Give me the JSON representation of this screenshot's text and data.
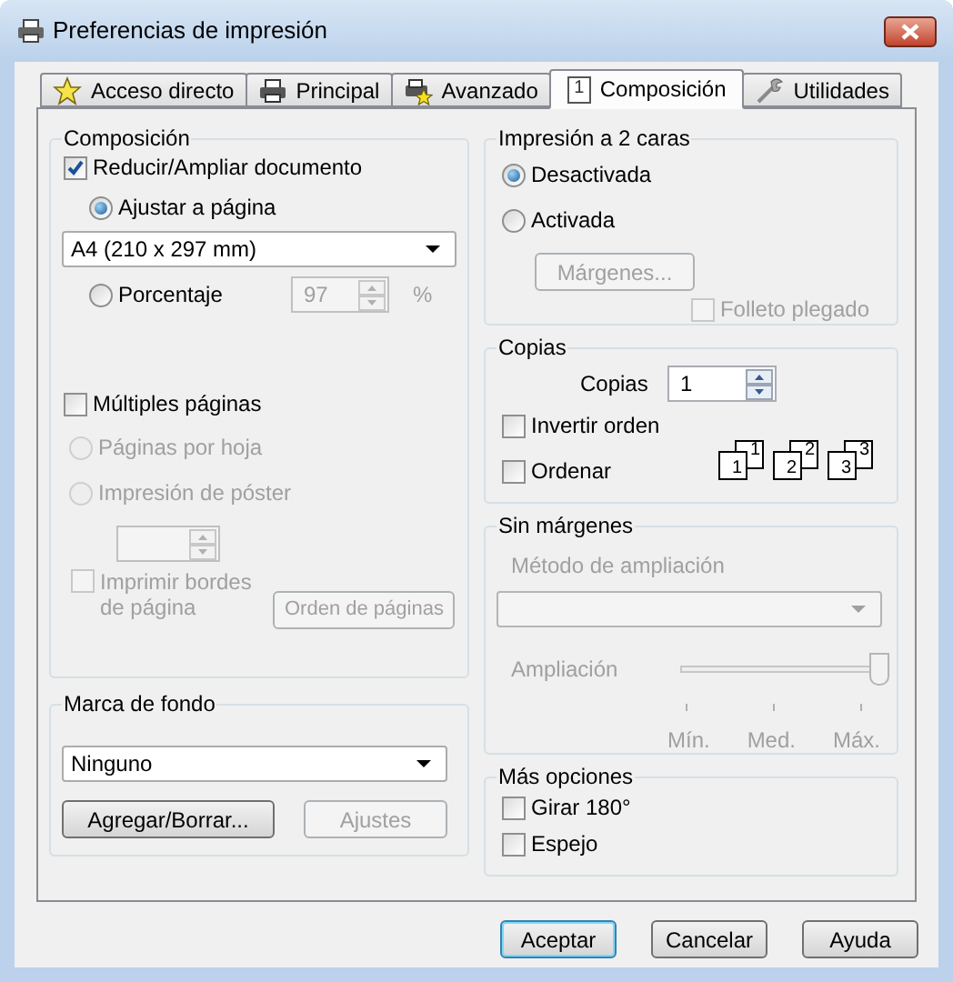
{
  "window": {
    "title": "Preferencias de impresión"
  },
  "tabs": [
    {
      "label": "Acceso directo",
      "kind": "star",
      "selected": false
    },
    {
      "label": "Principal",
      "kind": "printer",
      "selected": false
    },
    {
      "label": "Avanzado",
      "kind": "printer-star",
      "selected": false
    },
    {
      "label": "Composición",
      "kind": "page",
      "icon_label": "1",
      "selected": true
    },
    {
      "label": "Utilidades",
      "kind": "wrench",
      "selected": false
    }
  ],
  "composition": {
    "title": "Composición",
    "reduce": {
      "label": "Reducir/Ampliar documento",
      "checked": true
    },
    "fit_page": {
      "label": "Ajustar a página",
      "selected": true
    },
    "paper_size": {
      "value": "A4 (210 x 297 mm)"
    },
    "percentage": {
      "label": "Porcentaje",
      "selected": false,
      "value": "97",
      "unit": "%",
      "disabled": true
    },
    "multiple_pages": {
      "label": "Múltiples páginas",
      "checked": false
    },
    "pages_per_sheet": {
      "label": "Páginas por hoja",
      "selected": false,
      "disabled": true
    },
    "poster": {
      "label": "Impresión de póster",
      "selected": false,
      "disabled": true
    },
    "poster_count": {
      "disabled": true
    },
    "print_borders": {
      "label": "Imprimir bordes de página",
      "checked": false,
      "disabled": true
    },
    "page_order_button": {
      "label": "Orden de páginas",
      "disabled": true
    }
  },
  "watermark": {
    "title": "Marca de fondo",
    "value": "Ninguno",
    "buttons": [
      {
        "label": "Agregar/Borrar...",
        "disabled": false
      },
      {
        "label": "Ajustes",
        "disabled": true
      }
    ]
  },
  "duplex": {
    "title": "Impresión a 2 caras",
    "options": [
      {
        "label": "Desactivada",
        "selected": true
      },
      {
        "label": "Activada",
        "selected": false
      }
    ],
    "margins_button": {
      "label": "Márgenes...",
      "disabled": true
    },
    "booklet": {
      "label": "Folleto plegado",
      "checked": false,
      "disabled": true
    }
  },
  "copies": {
    "title": "Copias",
    "label": "Copias",
    "value": "1",
    "reverse": {
      "label": "Invertir orden",
      "checked": false
    },
    "collate": {
      "label": "Ordenar",
      "checked": false
    },
    "collate_icons": [
      {
        "front": "1",
        "back": "1"
      },
      {
        "front": "2",
        "back": "2"
      },
      {
        "front": "3",
        "back": "3"
      }
    ]
  },
  "borderless": {
    "title": "Sin márgenes",
    "method_label": "Método de ampliación",
    "disabled": true,
    "enlargement_label": "Ampliación",
    "level": 1,
    "ticks": [
      "Mín.",
      "Med.",
      "Máx."
    ]
  },
  "more_options": {
    "title": "Más opciones",
    "options": [
      {
        "label": "Girar 180°",
        "checked": false
      },
      {
        "label": "Espejo",
        "checked": false
      }
    ]
  },
  "buttons": [
    {
      "label": "Aceptar",
      "default": true
    },
    {
      "label": "Cancelar",
      "default": false
    },
    {
      "label": "Ayuda",
      "default": false
    }
  ]
}
